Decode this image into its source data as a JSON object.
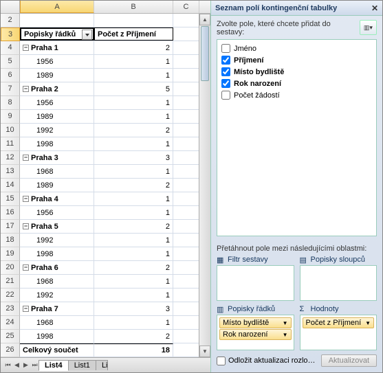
{
  "columns": [
    "A",
    "B",
    "C"
  ],
  "pivot": {
    "header_a": "Popisky řádků",
    "header_b": "Počet z Příjmení",
    "total_label": "Celkový součet",
    "total_value": 18,
    "groups": [
      {
        "name": "Praha 1",
        "value": 2,
        "children": [
          {
            "y": "1956",
            "v": 1
          },
          {
            "y": "1989",
            "v": 1
          }
        ]
      },
      {
        "name": "Praha 2",
        "value": 5,
        "children": [
          {
            "y": "1956",
            "v": 1
          },
          {
            "y": "1989",
            "v": 1
          },
          {
            "y": "1992",
            "v": 2
          },
          {
            "y": "1998",
            "v": 1
          }
        ]
      },
      {
        "name": "Praha 3",
        "value": 3,
        "children": [
          {
            "y": "1968",
            "v": 1
          },
          {
            "y": "1989",
            "v": 2
          }
        ]
      },
      {
        "name": "Praha 4",
        "value": 1,
        "children": [
          {
            "y": "1956",
            "v": 1
          }
        ]
      },
      {
        "name": "Praha 5",
        "value": 2,
        "children": [
          {
            "y": "1992",
            "v": 1
          },
          {
            "y": "1998",
            "v": 1
          }
        ]
      },
      {
        "name": "Praha 6",
        "value": 2,
        "children": [
          {
            "y": "1968",
            "v": 1
          },
          {
            "y": "1992",
            "v": 1
          }
        ]
      },
      {
        "name": "Praha 7",
        "value": 3,
        "children": [
          {
            "y": "1968",
            "v": 1
          },
          {
            "y": "1998",
            "v": 2
          }
        ]
      }
    ]
  },
  "tabs": [
    "List4",
    "List1",
    "Li"
  ],
  "pane": {
    "title": "Seznam polí kontingenční tabulky",
    "instruction": "Zvolte pole, které chcete přidat do sestavy:",
    "fields": [
      {
        "label": "Jméno",
        "checked": false
      },
      {
        "label": "Příjmení",
        "checked": true
      },
      {
        "label": "Místo bydliště",
        "checked": true
      },
      {
        "label": "Rok narození",
        "checked": true
      },
      {
        "label": "Počet žádostí",
        "checked": false
      }
    ],
    "drag_label": "Přetáhnout pole mezi následujícími oblastmi:",
    "areas": {
      "filter": "Filtr sestavy",
      "columns": "Popisky sloupců",
      "rows": "Popisky řádků",
      "values": "Hodnoty"
    },
    "row_pills": [
      "Místo bydliště",
      "Rok narození"
    ],
    "value_pills": [
      "Počet z Příjmení"
    ],
    "defer": "Odložit aktualizaci rozlo…",
    "update": "Aktualizovat"
  }
}
